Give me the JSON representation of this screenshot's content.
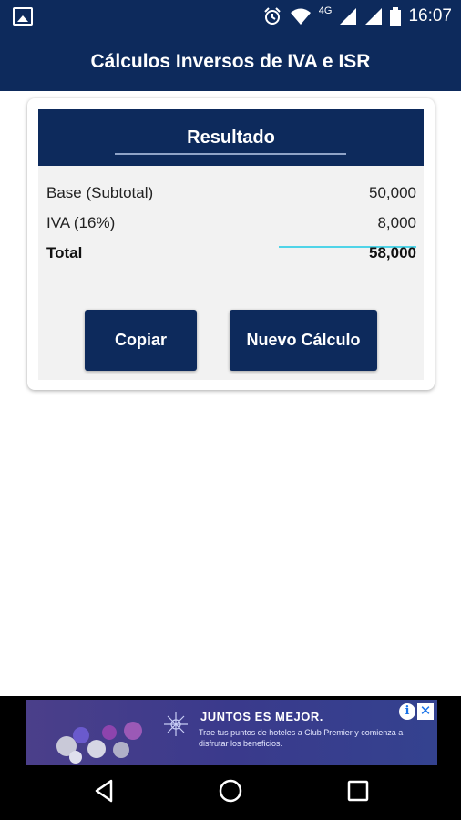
{
  "status_bar": {
    "time": "16:07",
    "network": "4G",
    "icons": [
      "gallery-icon",
      "alarm-icon",
      "wifi-icon",
      "signal-icon",
      "battery-icon"
    ]
  },
  "app_bar": {
    "title": "Cálculos Inversos de IVA e ISR"
  },
  "result_card": {
    "header": "Resultado",
    "rows": [
      {
        "label": "Base (Subtotal)",
        "value": "50,000"
      },
      {
        "label": "IVA (16%)",
        "value": "8,000"
      },
      {
        "label": "Total",
        "value": "58,000"
      }
    ],
    "buttons": {
      "copy": "Copiar",
      "new": "Nuevo Cálculo"
    }
  },
  "ad": {
    "headline": "JUNTOS ES MEJOR.",
    "body": "Trae tus puntos de hoteles a Club Premier y comienza a disfrutar los beneficios.",
    "info": "i",
    "close": "✕"
  },
  "nav": {
    "icons": [
      "back-icon",
      "home-icon",
      "recents-icon"
    ]
  },
  "colors": {
    "primary": "#0d2a5c",
    "card_bg": "#f2f2f2",
    "accent_line": "#4fd4e8"
  }
}
